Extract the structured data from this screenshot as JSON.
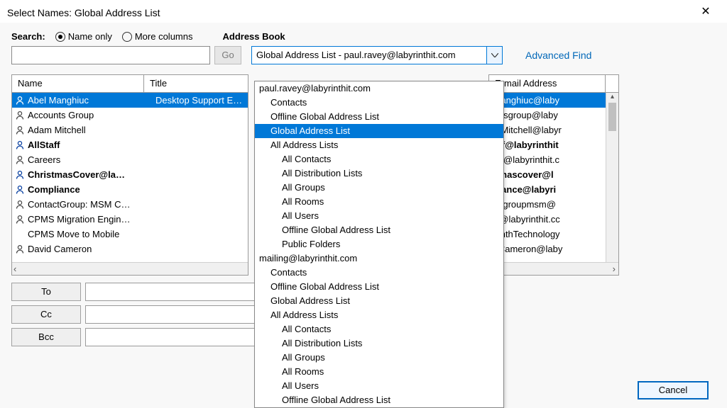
{
  "titlebar": {
    "title": "Select Names: Global Address List"
  },
  "search": {
    "label": "Search:",
    "name_only": "Name only",
    "more_columns": "More columns",
    "go": "Go"
  },
  "address_book": {
    "label": "Address Book",
    "selected": "Global Address List - paul.ravey@labyrinthit.com",
    "advanced_find": "Advanced Find"
  },
  "columns": {
    "name": "Name",
    "title": "Title",
    "email": "E-mail Address"
  },
  "entries": [
    {
      "name": "Abel Manghiuc",
      "title": "Desktop Support E…",
      "email": ".Manghiuc@laby",
      "bold": false,
      "selected": true,
      "icon": true
    },
    {
      "name": "Accounts Group",
      "title": "",
      "email": "untsgroup@laby",
      "bold": false,
      "selected": false,
      "icon": true
    },
    {
      "name": "Adam Mitchell",
      "title": "",
      "email": "m.Mitchell@labyr",
      "bold": false,
      "selected": false,
      "icon": true
    },
    {
      "name": "AllStaff",
      "title": "",
      "email": "taff@labyrinthit",
      "bold": true,
      "selected": false,
      "icon": true
    },
    {
      "name": "Careers",
      "title": "",
      "email": "ers@labyrinthit.c",
      "bold": false,
      "selected": false,
      "icon": true
    },
    {
      "name": "ChristmasCover@la…",
      "title": "",
      "email": "stmascover@l",
      "bold": true,
      "selected": false,
      "icon": true
    },
    {
      "name": "Compliance",
      "title": "",
      "email": "pliance@labyri",
      "bold": true,
      "selected": false,
      "icon": true
    },
    {
      "name": "ContactGroup: MSM C…",
      "title": "",
      "email": "actgroupmsm@",
      "bold": false,
      "selected": false,
      "icon": true
    },
    {
      "name": "CPMS Migration Engin…",
      "title": "",
      "email": "IS@labyrinthit.cc",
      "bold": false,
      "selected": false,
      "icon": true
    },
    {
      "name": "CPMS Move to Mobile",
      "title": "",
      "email": "yrinthTechnology",
      "bold": false,
      "selected": false,
      "icon": false
    },
    {
      "name": "David Cameron",
      "title": "",
      "email": "d Cameron@laby",
      "bold": false,
      "selected": false,
      "icon": true
    }
  ],
  "scroll": {
    "left_chevron": "‹",
    "right_chevron": "›",
    "up_caret": "▴",
    "down_caret": "▾"
  },
  "recipients": {
    "to": "To",
    "cc": "Cc",
    "bcc": "Bcc"
  },
  "buttons": {
    "cancel": "Cancel"
  },
  "dropdown": [
    {
      "text": "paul.ravey@labyrinthit.com",
      "indent": 0,
      "selected": false
    },
    {
      "text": "Contacts",
      "indent": 1,
      "selected": false
    },
    {
      "text": "Offline Global Address List",
      "indent": 1,
      "selected": false
    },
    {
      "text": "Global Address List",
      "indent": 1,
      "selected": true
    },
    {
      "text": "All Address Lists",
      "indent": 1,
      "selected": false
    },
    {
      "text": "All Contacts",
      "indent": 2,
      "selected": false
    },
    {
      "text": "All Distribution Lists",
      "indent": 2,
      "selected": false
    },
    {
      "text": "All Groups",
      "indent": 2,
      "selected": false
    },
    {
      "text": "All Rooms",
      "indent": 2,
      "selected": false
    },
    {
      "text": "All Users",
      "indent": 2,
      "selected": false
    },
    {
      "text": "Offline Global Address List",
      "indent": 2,
      "selected": false
    },
    {
      "text": "Public Folders",
      "indent": 2,
      "selected": false
    },
    {
      "text": "mailing@labyrinthit.com",
      "indent": 0,
      "selected": false
    },
    {
      "text": "Contacts",
      "indent": 1,
      "selected": false
    },
    {
      "text": "Offline Global Address List",
      "indent": 1,
      "selected": false
    },
    {
      "text": "Global Address List",
      "indent": 1,
      "selected": false
    },
    {
      "text": "All Address Lists",
      "indent": 1,
      "selected": false
    },
    {
      "text": "All Contacts",
      "indent": 2,
      "selected": false
    },
    {
      "text": "All Distribution Lists",
      "indent": 2,
      "selected": false
    },
    {
      "text": "All Groups",
      "indent": 2,
      "selected": false
    },
    {
      "text": "All Rooms",
      "indent": 2,
      "selected": false
    },
    {
      "text": "All Users",
      "indent": 2,
      "selected": false
    },
    {
      "text": "Offline Global Address List",
      "indent": 2,
      "selected": false
    }
  ]
}
